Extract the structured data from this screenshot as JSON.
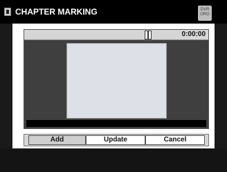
{
  "header": {
    "title": "CHAPTER MARKING",
    "badge_line1": "DVR",
    "badge_line2": "ORG",
    "title_icon": "disc-tray-icon"
  },
  "player": {
    "time": "0:00:00",
    "state_icon": "pause-icon"
  },
  "buttons": {
    "add": "Add",
    "update": "Update",
    "cancel": "Cancel"
  },
  "colors": {
    "title_bg": "#000000",
    "panel_bg": "#ffffff",
    "player_bg": "#3f3f3f",
    "video_bg": "#dde0e6"
  }
}
